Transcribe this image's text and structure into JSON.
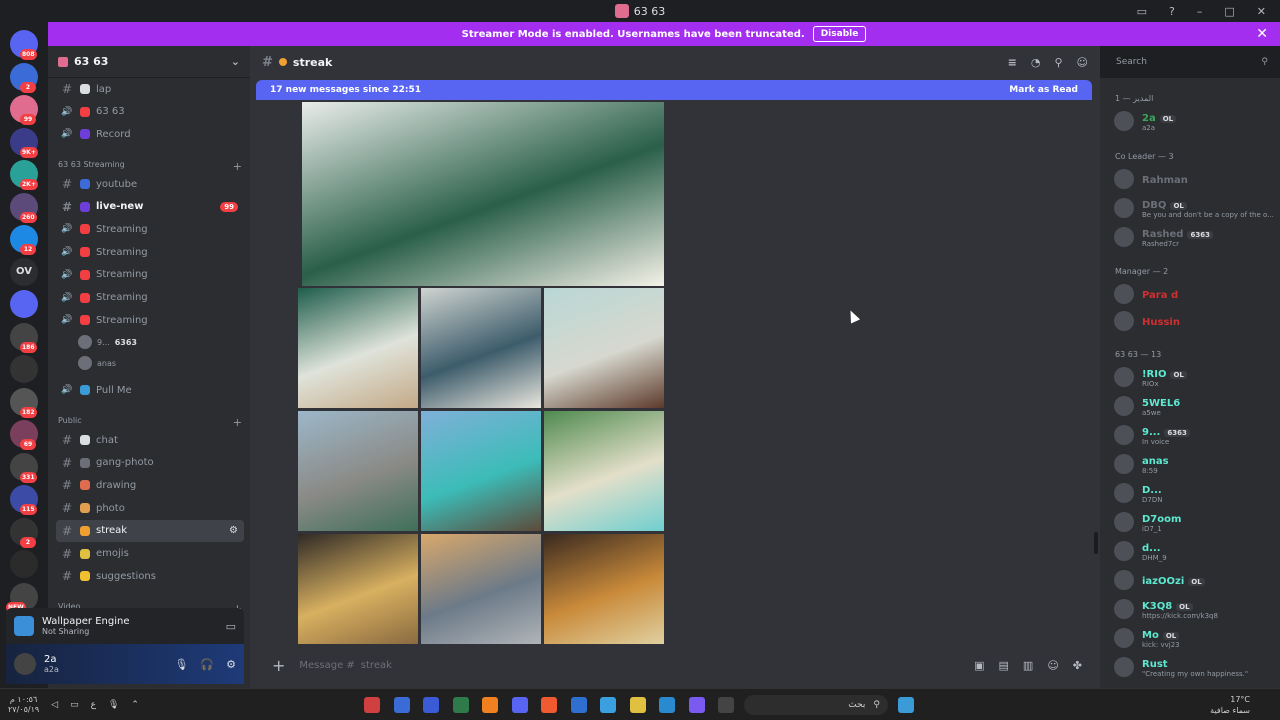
{
  "window": {
    "title": "63 63"
  },
  "banner": {
    "text": "Streamer Mode is enabled. Usernames have been truncated.",
    "button": "Disable"
  },
  "server_rail": {
    "items": [
      {
        "badge": "808",
        "color": "#5865f2"
      },
      {
        "badge": "2",
        "color": "#3b6bd6"
      },
      {
        "badge": "99",
        "color": "#e06c8f"
      },
      {
        "badge": "9K+",
        "color": "#3a3c8a"
      },
      {
        "badge": "2K+",
        "color": "#2aa198"
      },
      {
        "badge": "260",
        "color": "#5c4a7a"
      },
      {
        "badge": "12",
        "color": "#1e88e5"
      },
      {
        "label": "OV",
        "color": "#2b2d31"
      },
      {
        "badge": "",
        "color": "#5865f2"
      },
      {
        "badge": "186",
        "color": "#444"
      },
      {
        "badge": "",
        "color": "#333"
      },
      {
        "badge": "182",
        "color": "#555"
      },
      {
        "badge": "69",
        "color": "#7a3f5c"
      },
      {
        "badge": "331",
        "color": "#444"
      },
      {
        "badge": "115",
        "color": "#3b4ba6"
      },
      {
        "badge": "2",
        "color": "#333"
      },
      {
        "badge": "",
        "color": "#2b2b2b"
      },
      {
        "badge": "NEW",
        "color": "#444"
      }
    ]
  },
  "server": {
    "name": "63 63"
  },
  "channels": {
    "top": [
      {
        "name": "lap",
        "type": "text",
        "emoji_color": "#dbdee1"
      },
      {
        "name": "63 63",
        "type": "voice",
        "emoji_color": "#f23f43"
      },
      {
        "name": "Record",
        "type": "voice",
        "emoji_color": "#6d3fd8"
      }
    ],
    "streaming_category": "63 63 Streaming",
    "streaming": [
      {
        "name": "youtube",
        "type": "text",
        "emoji_color": "#3b6bd6"
      },
      {
        "name": "live-new",
        "type": "text",
        "emoji_color": "#6d3fd8",
        "unread": true,
        "mention": "99"
      },
      {
        "name": "Streaming",
        "type": "voice",
        "emoji_color": "#f23f43"
      },
      {
        "name": "Streaming",
        "type": "voice",
        "emoji_color": "#f23f43"
      },
      {
        "name": "Streaming",
        "type": "voice",
        "emoji_color": "#f23f43"
      },
      {
        "name": "Streaming",
        "type": "voice",
        "emoji_color": "#f23f43"
      },
      {
        "name": "Streaming",
        "type": "voice",
        "emoji_color": "#f23f43"
      }
    ],
    "voice_users": [
      {
        "name": "9...",
        "tag": "6363"
      },
      {
        "name": "anas",
        "tag": ""
      }
    ],
    "pull": {
      "name": "Pull Me",
      "type": "voice",
      "emoji_color": "#3b9bd6"
    },
    "public_category": "Public",
    "public": [
      {
        "name": "chat",
        "type": "text",
        "emoji_color": "#dbdee1"
      },
      {
        "name": "gang-photo",
        "type": "text",
        "emoji_color": "#6d6f78"
      },
      {
        "name": "drawing",
        "type": "text",
        "emoji_color": "#e06c50"
      },
      {
        "name": "photo",
        "type": "text",
        "emoji_color": "#e0a050"
      },
      {
        "name": "streak",
        "type": "text",
        "emoji_color": "#f0a030",
        "active": true
      },
      {
        "name": "emojis",
        "type": "text",
        "emoji_color": "#e0c040"
      },
      {
        "name": "suggestions",
        "type": "text",
        "emoji_color": "#f0c030"
      }
    ],
    "video_category": "Video"
  },
  "activity": {
    "title": "Wallpaper Engine",
    "status": "Not Sharing"
  },
  "user": {
    "name": "2a",
    "status": "a2a"
  },
  "chat": {
    "channel": "streak",
    "new_messages": "17 new messages since 22:51",
    "mark_read": "Mark as Read",
    "composer_placeholder": "Message #",
    "composer_channel": "streak",
    "images": [
      {
        "colors": [
          "#e9ede9",
          "#2a5f4a",
          "#f5f2e8"
        ]
      },
      {
        "colors": [
          "#1f5d4c",
          "#dfe3da",
          "#c4a987"
        ]
      },
      {
        "colors": [
          "#cfd4d0",
          "#3d5c6b",
          "#e9e6de"
        ]
      },
      {
        "colors": [
          "#b9d7d5",
          "#d7d8cf",
          "#5d3a2a"
        ]
      },
      {
        "colors": [
          "#9cb7c9",
          "#8a8a86",
          "#3f6f5a"
        ]
      },
      {
        "colors": [
          "#7fb0d8",
          "#3cbcb8",
          "#5d4a3a"
        ]
      },
      {
        "colors": [
          "#4f8a4f",
          "#e3dfc9",
          "#6fcfd0"
        ]
      },
      {
        "colors": [
          "#2f2a26",
          "#d8b060",
          "#8a6a40"
        ]
      },
      {
        "colors": [
          "#d9a86c",
          "#6c7a88",
          "#b0b4b8"
        ]
      },
      {
        "colors": [
          "#3a2a20",
          "#c98a3a",
          "#e0d0a0"
        ]
      }
    ]
  },
  "search": {
    "placeholder": "Search"
  },
  "members": {
    "groups": [
      {
        "label": "المدير — 1",
        "members": [
          {
            "name": "2a",
            "status": "a2a",
            "color": "#3ba55d",
            "tag": "OL"
          }
        ]
      },
      {
        "label": "Co Leader — 3",
        "members": [
          {
            "name": "Rahman",
            "status": "",
            "color": "#6d6f78"
          },
          {
            "name": "DBQ",
            "status": "Be you and don't be a copy of the o...",
            "color": "#6d6f78",
            "tag": "OL"
          },
          {
            "name": "Rashed",
            "status": "Rashed7cr",
            "color": "#6d6f78",
            "tag": "6363"
          }
        ]
      },
      {
        "label": "Manager — 2",
        "members": [
          {
            "name": "Para d",
            "status": "",
            "color": "#d03030"
          },
          {
            "name": "Hussin",
            "status": "",
            "color": "#d03030"
          }
        ]
      },
      {
        "label": "63 63 — 13",
        "members": [
          {
            "name": "!RIO",
            "status": "RIOx",
            "color": "#5de8d0",
            "tag": "OL"
          },
          {
            "name": "5WEL6",
            "status": "a5we",
            "color": "#5de8d0"
          },
          {
            "name": "9...",
            "status": "In voice",
            "color": "#5de8d0",
            "tag": "6363"
          },
          {
            "name": "anas",
            "status": "8:59",
            "color": "#5de8d0"
          },
          {
            "name": "D...",
            "status": "D7DN",
            "color": "#5de8d0"
          },
          {
            "name": "D7oom",
            "status": "iD7_1",
            "color": "#5de8d0"
          },
          {
            "name": "d...",
            "status": "DHM_9",
            "color": "#5de8d0"
          },
          {
            "name": "iazOOzi",
            "status": "",
            "color": "#5de8d0",
            "tag": "OL"
          },
          {
            "name": "K3Q8",
            "status": "https://kick.com/k3q8",
            "color": "#5de8d0",
            "tag": "OL"
          },
          {
            "name": "Mo",
            "status": "kick: vvj23",
            "color": "#5de8d0",
            "tag": "OL"
          },
          {
            "name": "Rust",
            "status": "\"Creating my own happiness.\"",
            "color": "#5de8d0"
          }
        ]
      }
    ]
  },
  "taskbar": {
    "time": "١٠:٥٦ م",
    "date": "٢٧/٠٥/١٩",
    "lang": "ع",
    "search_placeholder": "بحث",
    "weather_temp": "17°C",
    "weather_desc": "سماء صافية"
  }
}
